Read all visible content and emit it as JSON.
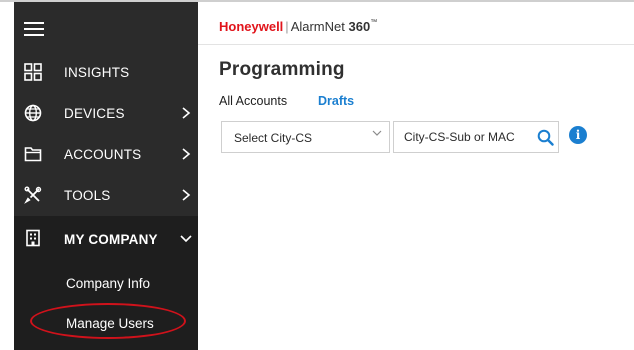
{
  "sidebar": {
    "items": [
      {
        "label": "INSIGHTS",
        "icon": "grid-icon"
      },
      {
        "label": "DEVICES",
        "icon": "globe-icon"
      },
      {
        "label": "ACCOUNTS",
        "icon": "folder-icon"
      },
      {
        "label": "TOOLS",
        "icon": "tools-icon"
      },
      {
        "label": "MY COMPANY",
        "icon": "building-icon"
      }
    ],
    "subitems": [
      {
        "label": "Company Info"
      },
      {
        "label": "Manage Users"
      }
    ]
  },
  "header": {
    "brand": "Honeywell",
    "sep": "|",
    "product_prefix": "AlarmNet ",
    "product_bold": "360",
    "tm": "™"
  },
  "main": {
    "title": "Programming",
    "tabs": [
      {
        "label": "All Accounts"
      },
      {
        "label": "Drafts"
      }
    ],
    "select": {
      "value": "Select City-CS"
    },
    "search": {
      "placeholder": "City-CS-Sub or MAC"
    },
    "info": "i"
  },
  "colors": {
    "sidebar_bg": "#2b2b2b",
    "brand_red": "#e1141b",
    "accent_blue": "#1b7fd0",
    "highlight": "#d0121b"
  }
}
